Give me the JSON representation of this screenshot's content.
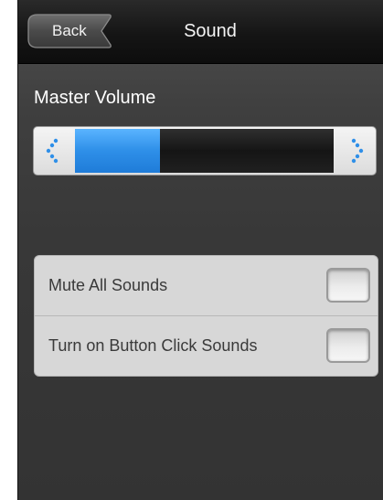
{
  "nav": {
    "back_label": "Back",
    "title": "Sound"
  },
  "volume": {
    "label": "Master Volume",
    "level": 0.33,
    "decrease_icon": "chevron-left-icon",
    "increase_icon": "chevron-right-icon",
    "fill_color": "#3a9cf2"
  },
  "settings": {
    "items": [
      {
        "label": "Mute All Sounds",
        "checked": false
      },
      {
        "label": "Turn on Button Click Sounds",
        "checked": false
      }
    ]
  }
}
